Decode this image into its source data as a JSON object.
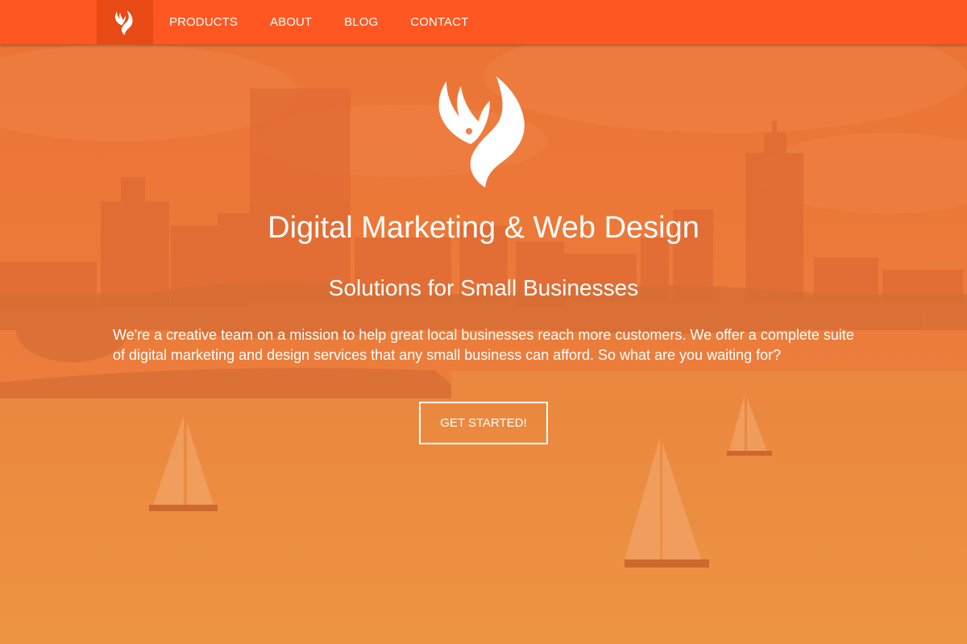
{
  "colors": {
    "nav_bg": "#ff5722",
    "nav_logo_bg": "#e84a15",
    "overlay": "#f07a2a",
    "text": "#ffffff"
  },
  "nav": {
    "logo_icon": "phoenix-icon",
    "items": [
      {
        "label": "PRODUCTS"
      },
      {
        "label": "ABOUT"
      },
      {
        "label": "BLOG"
      },
      {
        "label": "CONTACT"
      }
    ]
  },
  "hero": {
    "logo_icon": "phoenix-icon",
    "title": "Digital Marketing & Web Design",
    "subtitle": "Solutions for Small Businesses",
    "text": "We're a creative team on a mission to help great local businesses reach more customers. We offer a complete suite of digital marketing and design services that any small business can afford. So what are you waiting for?",
    "cta_label": "GET STARTED!",
    "background": "city-skyline-harbor-sailboats-image"
  }
}
